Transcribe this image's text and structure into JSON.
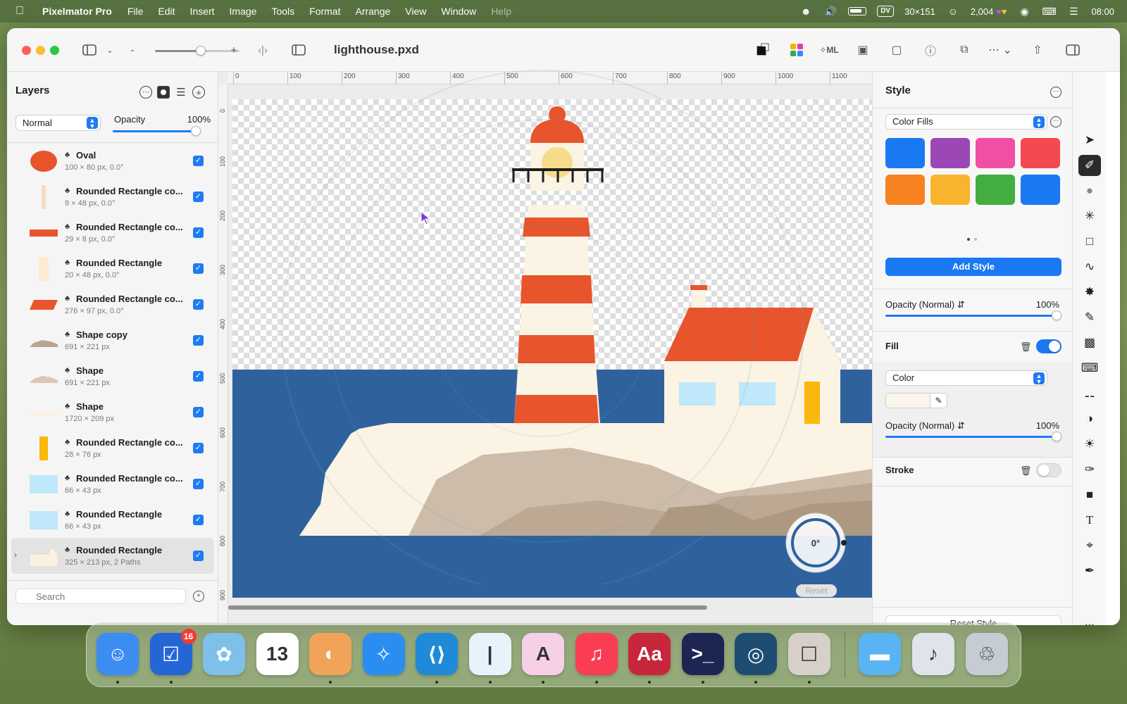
{
  "menubar": {
    "app_name": "Pixelmator Pro",
    "menus": [
      "File",
      "Edit",
      "Insert",
      "Image",
      "Tools",
      "Format",
      "Arrange",
      "View",
      "Window",
      "Help"
    ],
    "status": {
      "pill": "DV",
      "coords": "30×151",
      "points": "2,004",
      "clock": "08:00"
    }
  },
  "window": {
    "doc_title": "lighthouse.pxd",
    "zoom_minus": "-",
    "zoom_plus": "+"
  },
  "layers": {
    "title": "Layers",
    "blend_mode": "Normal",
    "opacity_label": "Opacity",
    "opacity_value": "100%",
    "opacity_fraction": 1.0,
    "search_placeholder": "Search",
    "items": [
      {
        "name": "Oval",
        "sub": "100 × 80 px, 0.0°",
        "thumb": "#e8542c",
        "shape": "oval"
      },
      {
        "name": "Rounded Rectangle co...",
        "sub": "9 × 48 px, 0.0°",
        "thumb": "#f3ddc0",
        "shape": "thin"
      },
      {
        "name": "Rounded Rectangle co...",
        "sub": "29 × 8 px, 0.0°",
        "thumb": "#e8542c",
        "shape": "bar"
      },
      {
        "name": "Rounded Rectangle",
        "sub": "20 × 48 px, 0.0°",
        "thumb": "#fdebd2",
        "shape": "tall"
      },
      {
        "name": "Rounded Rectangle co...",
        "sub": "276 × 97 px, 0.0°",
        "thumb": "#e8542c",
        "shape": "para"
      },
      {
        "name": "Shape copy",
        "sub": "691 × 221 px",
        "thumb": "#b8a591",
        "shape": "hill"
      },
      {
        "name": "Shape",
        "sub": "691 × 221 px",
        "thumb": "#d9c8b3",
        "shape": "hill"
      },
      {
        "name": "Shape",
        "sub": "1720 × 209 px",
        "thumb": "#faf1e4",
        "shape": "flat"
      },
      {
        "name": "Rounded Rectangle co...",
        "sub": "28 × 76 px",
        "thumb": "#f9b80b",
        "shape": "door"
      },
      {
        "name": "Rounded Rectangle co...",
        "sub": "66 × 43 px",
        "thumb": "#bfe8fb",
        "shape": "window"
      },
      {
        "name": "Rounded Rectangle",
        "sub": "66 × 43 px",
        "thumb": "#bfe8fb",
        "shape": "window"
      },
      {
        "name": "Rounded Rectangle",
        "sub": "325 × 213 px, 2 Paths",
        "thumb": "#faf1e4",
        "shape": "house",
        "selected": true
      }
    ]
  },
  "rulers": {
    "top": [
      "0",
      "100",
      "200",
      "300",
      "400",
      "500",
      "600",
      "700",
      "800",
      "900",
      "1000",
      "1100"
    ],
    "left": [
      "0",
      "100",
      "200",
      "300",
      "400",
      "500",
      "600",
      "700",
      "800",
      "900"
    ]
  },
  "canvas": {
    "rotation": "0°",
    "reset_label": "Reset",
    "colors": {
      "sea": "#2f629d",
      "stripe": "#e8542c",
      "cream": "#fbf3e3",
      "window_blue": "#bfe8fb",
      "door": "#f9b80b",
      "rock": "#cdbcaa"
    }
  },
  "style": {
    "title": "Style",
    "preset_select": "Color Fills",
    "swatches": [
      "#1a78f2",
      "#9b48b6",
      "#f24fa4",
      "#f44a4f",
      "#f6831f",
      "#f9b42e",
      "#43ad3f",
      "#1a78f2"
    ],
    "add_style": "Add Style",
    "opacity_label": "Opacity (Normal)",
    "opacity_value": "100%",
    "fill_title": "Fill",
    "fill_type": "Color",
    "fill_opacity_label": "Opacity (Normal)",
    "fill_opacity_value": "100%",
    "stroke_title": "Stroke",
    "reset_style": "Reset Style"
  },
  "dock": {
    "apps": [
      {
        "name": "finder-icon",
        "color": "#3c8df2",
        "glyph": "☺"
      },
      {
        "name": "tasks-icon",
        "color": "#2566d6",
        "glyph": "☑",
        "badge": "16"
      },
      {
        "name": "pinwheel-icon",
        "color": "#7ec0e9",
        "glyph": "✿"
      },
      {
        "name": "calendar-icon",
        "color": "#ffffff",
        "glyph": "13"
      },
      {
        "name": "pixelmator-icon",
        "color": "#f2a35a",
        "glyph": "◐"
      },
      {
        "name": "safari-icon",
        "color": "#2a8ef0",
        "glyph": "✧"
      },
      {
        "name": "vscode-icon",
        "color": "#1f8ad8",
        "glyph": "⟨⟩"
      },
      {
        "name": "editor-icon",
        "color": "#e8f2fb",
        "glyph": "|"
      },
      {
        "name": "design-icon",
        "color": "#f6d0e7",
        "glyph": "A"
      },
      {
        "name": "music-icon",
        "color": "#fa3d53",
        "glyph": "♫"
      },
      {
        "name": "dictionary-icon",
        "color": "#c8263c",
        "glyph": "Aa"
      },
      {
        "name": "terminal-icon",
        "color": "#1d2553",
        "glyph": ">_"
      },
      {
        "name": "globe-icon",
        "color": "#1e4d74",
        "glyph": "◎"
      },
      {
        "name": "robot-icon",
        "color": "#d6d0c8",
        "glyph": "☐"
      },
      {
        "name": "folder-icon",
        "color": "#5ab4f3",
        "glyph": "▬"
      },
      {
        "name": "audio-icon",
        "color": "#e0e4ea",
        "glyph": "♪"
      },
      {
        "name": "trash-icon",
        "color": "#c6ccd3",
        "glyph": "♲"
      }
    ]
  }
}
